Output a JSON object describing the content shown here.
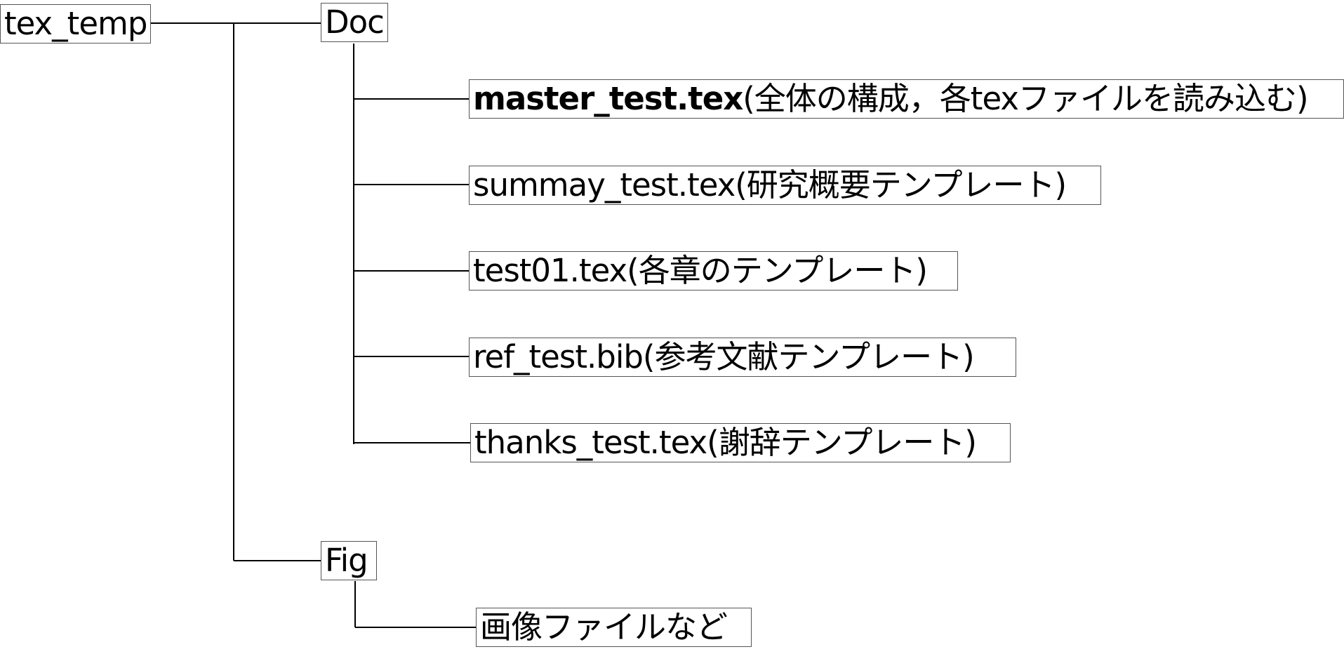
{
  "tree": {
    "root": {
      "label": "tex_temp"
    },
    "doc": {
      "label": "Doc",
      "files": [
        {
          "name": "master_test.tex",
          "note": "(全体の構成，各texファイルを読み込む)"
        },
        {
          "name": "summay_test.tex",
          "note": "(研究概要テンプレート)"
        },
        {
          "name": "test01.tex",
          "note": "(各章のテンプレート)"
        },
        {
          "name": "ref_test.bib",
          "note": "(参考文献テンプレート)"
        },
        {
          "name": "thanks_test.tex",
          "note": "(謝辞テンプレート)"
        }
      ]
    },
    "fig": {
      "label": "Fig",
      "files": [
        {
          "name": "画像ファイルなど"
        }
      ]
    }
  }
}
